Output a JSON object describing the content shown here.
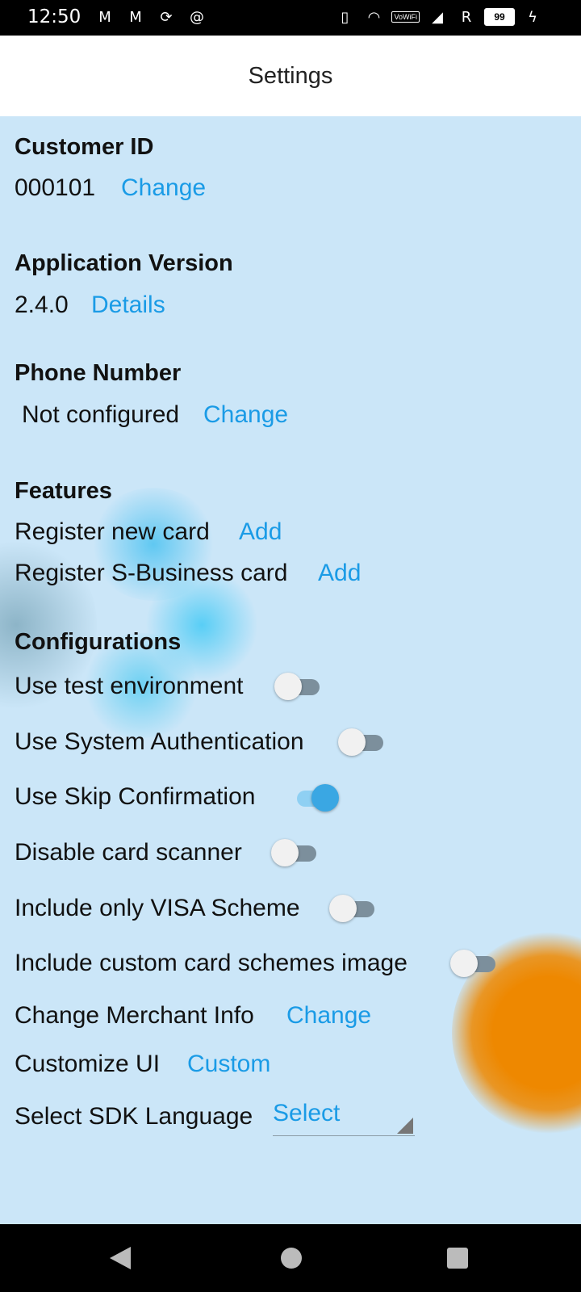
{
  "status_bar": {
    "time": "12:50",
    "left_icons": [
      "gmail-icon",
      "gmail-icon",
      "sync-icon",
      "at-icon"
    ],
    "vowifi_label": "VoWiFi",
    "roaming_label": "R",
    "battery_level": "99"
  },
  "header": {
    "title": "Settings"
  },
  "customer": {
    "title": "Customer ID",
    "value": "000101",
    "action": "Change"
  },
  "version": {
    "title": "Application Version",
    "value": "2.4.0",
    "action": "Details"
  },
  "phone": {
    "title": "Phone Number",
    "value": "Not configured",
    "action": "Change"
  },
  "features": {
    "title": "Features",
    "items": [
      {
        "label": "Register new card",
        "action": "Add"
      },
      {
        "label": "Register S-Business card",
        "action": "Add"
      }
    ]
  },
  "configurations": {
    "title": "Configurations",
    "toggles": [
      {
        "label": "Use test environment",
        "on": false
      },
      {
        "label": "Use System Authentication",
        "on": false
      },
      {
        "label": "Use Skip Confirmation",
        "on": true
      },
      {
        "label": "Disable card scanner",
        "on": false
      },
      {
        "label": "Include only VISA Scheme",
        "on": false
      },
      {
        "label": "Include custom card schemes image",
        "on": false
      }
    ],
    "merchant": {
      "label": "Change Merchant Info",
      "action": "Change"
    },
    "customize": {
      "label": "Customize UI",
      "action": "Custom"
    },
    "language": {
      "label": "Select SDK Language",
      "value": "Select"
    }
  },
  "colors": {
    "accent": "#1a9be6",
    "background": "#cbe6f8",
    "toggle_on": "#3aa7e3"
  }
}
